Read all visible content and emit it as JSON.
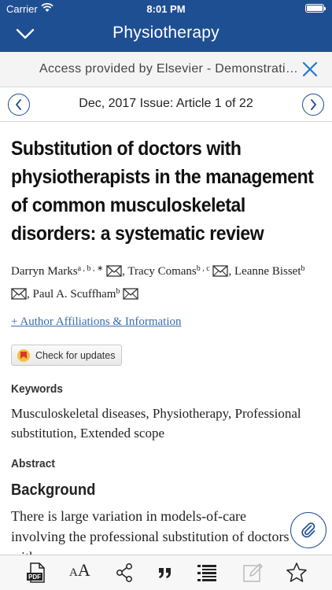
{
  "status_bar": {
    "carrier": "Carrier",
    "time": "8:01 PM"
  },
  "header": {
    "title": "Physiotherapy"
  },
  "access_banner": {
    "text": "Access provided by Elsevier - Demonstration"
  },
  "issue_nav": {
    "label": "Dec, 2017 Issue: Article 1 of 22"
  },
  "article": {
    "title": "Substitution of doctors with physiotherapists in the management of common musculoskeletal disorders: a systematic review",
    "authors": [
      {
        "name": "Darryn Marks",
        "sup": "a , b , ∗",
        "sep": ", "
      },
      {
        "name": "Tracy Comans",
        "sup": "b , c",
        "sep": ", "
      },
      {
        "name": "Leanne Bisset",
        "sup": "b",
        "sep": ""
      },
      {
        "name": "Paul A. Scuffham",
        "sup": "b",
        "sep": ""
      }
    ],
    "affiliations_link": "+ Author Affiliations & Information",
    "check_updates": "Check for updates",
    "keywords_heading": "Keywords",
    "keywords": "Musculoskeletal diseases, Physiotherapy, Professional substitution, Extended scope",
    "abstract_heading": "Abstract",
    "background_heading": "Background",
    "background_text": "There is large variation in models-of-care involving the professional substitution of doctors with"
  },
  "toolbar": {
    "items": [
      "pdf-icon",
      "text-size-icon",
      "share-icon",
      "quote-icon",
      "outline-icon",
      "note-icon",
      "star-icon"
    ],
    "text_size_glyph_small": "A",
    "text_size_glyph_large": "A"
  },
  "colors": {
    "brand": "#1f4f93",
    "link": "#3b6ab0"
  }
}
